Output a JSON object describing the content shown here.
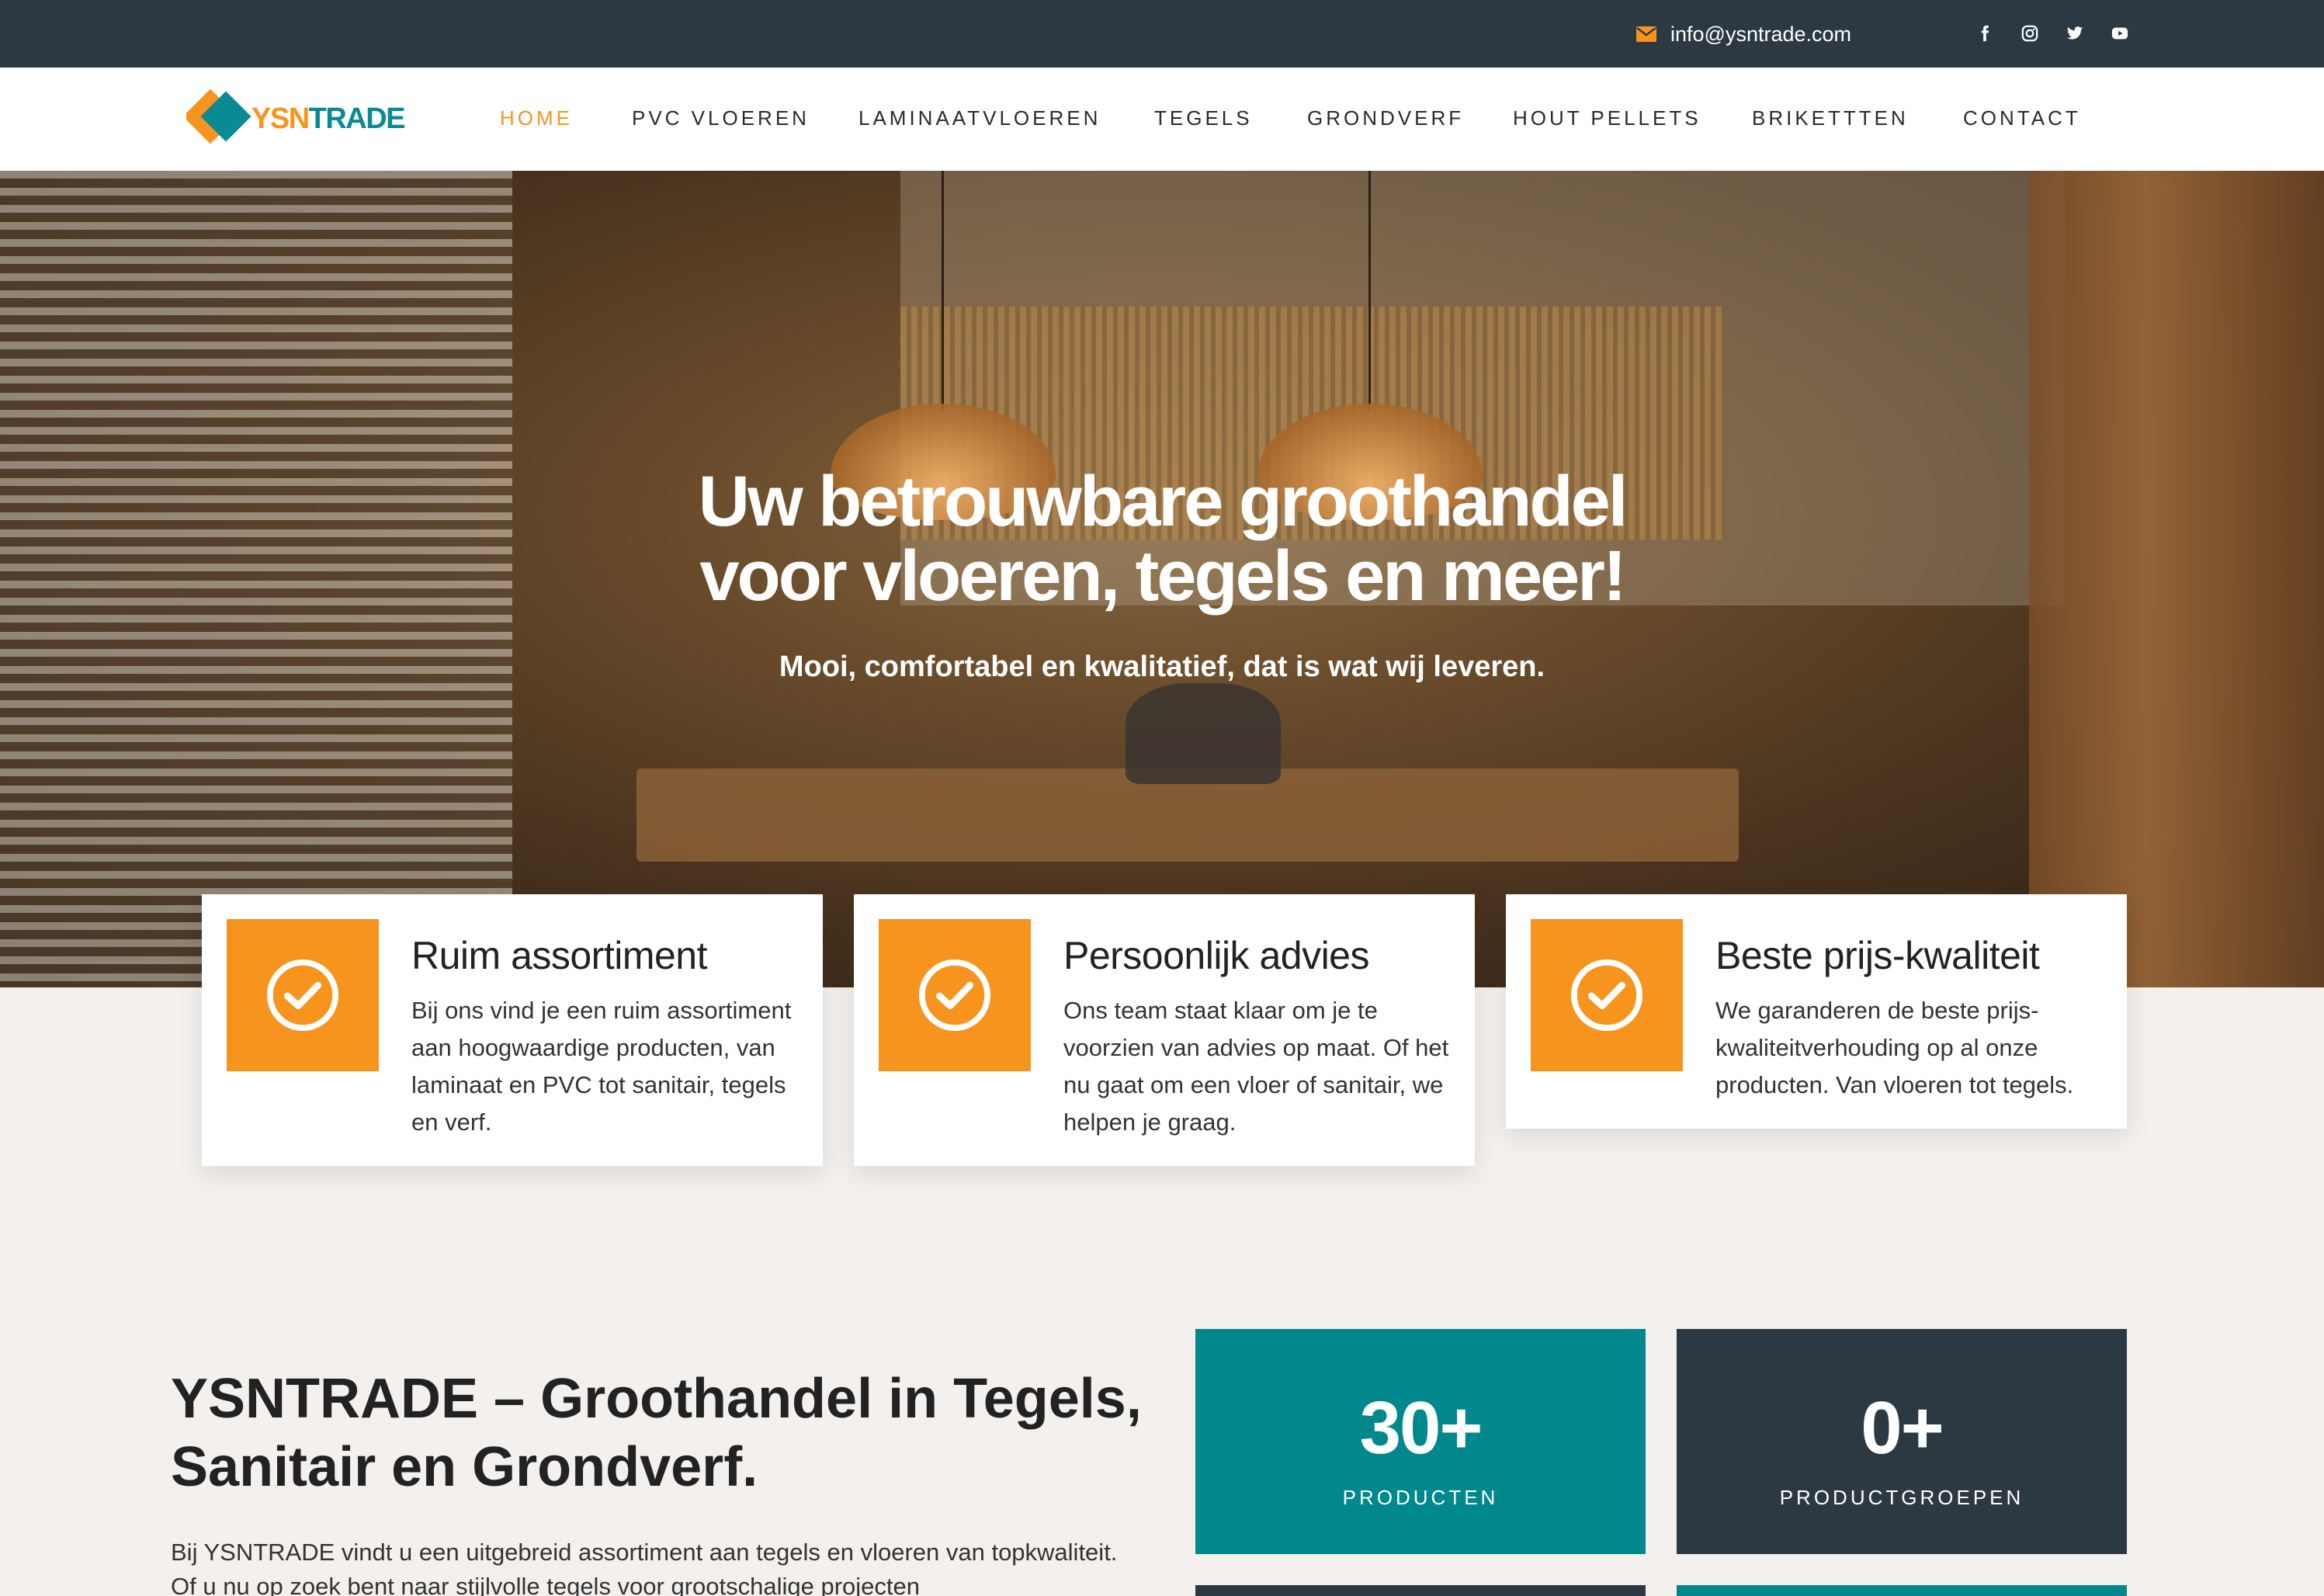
{
  "topbar": {
    "email": "info@ysntrade.com",
    "socials": [
      "facebook-icon",
      "instagram-icon",
      "twitter-icon",
      "youtube-icon"
    ]
  },
  "brand": {
    "name_part1": "YSN",
    "name_part2": "TRADE",
    "colors": {
      "orange": "#f7941d",
      "teal": "#0a8a93",
      "dark": "#2d3942"
    }
  },
  "nav": {
    "items": [
      {
        "label": "HOME",
        "active": true
      },
      {
        "label": "PVC VLOEREN"
      },
      {
        "label": "LAMINAATVLOEREN"
      },
      {
        "label": "TEGELS"
      },
      {
        "label": "GRONDVERF"
      },
      {
        "label": "HOUT PELLETS"
      },
      {
        "label": "BRIKETTTEN"
      },
      {
        "label": "CONTACT"
      }
    ]
  },
  "hero": {
    "title_line1": "Uw betrouwbare groothandel",
    "title_line2": "voor vloeren, tegels en meer!",
    "subtitle": "Mooi, comfortabel en kwalitatief, dat is wat wij leveren."
  },
  "features": [
    {
      "title": "Ruim assortiment",
      "text": "Bij ons vind je een ruim assortiment aan hoogwaardige producten, van laminaat en PVC tot sanitair, tegels en verf.",
      "icon": "check-circle-icon"
    },
    {
      "title": "Persoonlijk advies",
      "text": "Ons team staat klaar om je te voorzien van advies op maat. Of het nu gaat om een vloer of sanitair, we helpen je graag.",
      "icon": "check-circle-icon"
    },
    {
      "title": "Beste prijs-kwaliteit",
      "text": "We garanderen de beste prijs-kwaliteitverhouding op al onze producten. Van vloeren tot tegels.",
      "icon": "check-circle-icon"
    }
  ],
  "about": {
    "title": "YSNTRADE – Groothandel in Tegels, Sanitair en Grondverf.",
    "text": "Bij YSNTRADE vindt u een uitgebreid assortiment aan tegels en vloeren van topkwaliteit. Of u nu op zoek bent naar stijlvolle tegels voor grootschalige projecten"
  },
  "stats": [
    {
      "number": "30+",
      "label": "PRODUCTEN"
    },
    {
      "number": "0+",
      "label": "PRODUCTGROEPEN"
    }
  ]
}
